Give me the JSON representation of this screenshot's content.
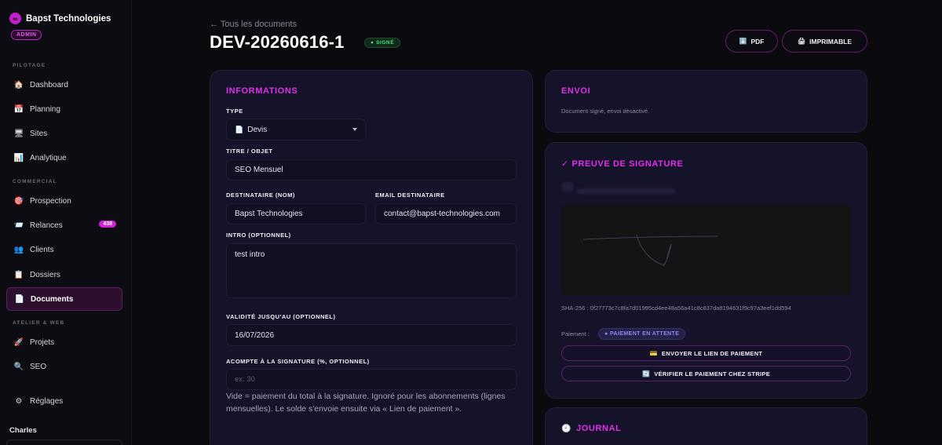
{
  "sidebar": {
    "brand_name": "Bapst Technologies",
    "role_badge": "ADMIN",
    "sections": {
      "pilotage": "PILOTAGE",
      "commercial": "COMMERCIAL",
      "atelier": "ATELIER & WEB"
    },
    "items": [
      {
        "label": "Dashboard",
        "icon": "house-icon"
      },
      {
        "label": "Planning",
        "icon": "calendar-icon"
      },
      {
        "label": "Sites",
        "icon": "monitor-icon"
      },
      {
        "label": "Analytique",
        "icon": "bar-chart-icon"
      },
      {
        "label": "Prospection",
        "icon": "target-icon"
      },
      {
        "label": "Relances",
        "icon": "envelope-icon",
        "badge": "438"
      },
      {
        "label": "Clients",
        "icon": "people-icon"
      },
      {
        "label": "Dossiers",
        "icon": "clipboard-icon"
      },
      {
        "label": "Documents",
        "icon": "document-icon",
        "active": true
      },
      {
        "label": "Projets",
        "icon": "rocket-icon"
      },
      {
        "label": "SEO",
        "icon": "magnifier-icon"
      },
      {
        "label": "Réglages",
        "icon": "gear-icon"
      }
    ],
    "user_name": "Charles"
  },
  "header": {
    "back_link": "← Tous les documents",
    "doc_id": "DEV-20260616-1",
    "status": "SIGNÉ",
    "pdf_button": "PDF",
    "print_button": "IMPRIMABLE"
  },
  "info": {
    "title": "INFORMATIONS",
    "type_label": "TYPE",
    "type_value": "Devis",
    "titre_label": "TITRE / OBJET",
    "titre_value": "SEO Mensuel",
    "dest_label": "DESTINATAIRE (NOM)",
    "dest_value": "Bapst Technologies",
    "email_label": "EMAIL DESTINATAIRE",
    "email_value": "contact@bapst-technologies.com",
    "intro_label": "INTRO (OPTIONNEL)",
    "intro_value": "test intro",
    "validite_label": "VALIDITÉ JUSQU'AU (OPTIONNEL)",
    "validite_value": "16/07/2026",
    "acompte_label": "ACOMPTE À LA SIGNATURE (%, OPTIONNEL)",
    "acompte_placeholder": "ex. 30",
    "help": "Vide = paiement du total à la signature. Ignoré pour les abonnements (lignes mensuelles). Le solde s'envoie ensuite via « Lien de paiement »."
  },
  "envoi": {
    "title": "ENVOI",
    "text": "Document signé, envoi désactivé."
  },
  "preuve": {
    "title": "✓ PREUVE DE SIGNATURE",
    "sha": "SHA-256 : 0f27773c7c8fa7d01995cd4ee48a56a41c8c837da8194631f9c97a3eef1dd594",
    "payment_label": "Paiement :",
    "payment_status": "● PAIEMENT EN ATTENTE",
    "send_link_button": "ENVOYER LE LIEN DE PAIEMENT",
    "verify_button": "VÉRIFIER LE PAIEMENT CHEZ STRIPE"
  },
  "journal": {
    "title": "JOURNAL"
  }
}
